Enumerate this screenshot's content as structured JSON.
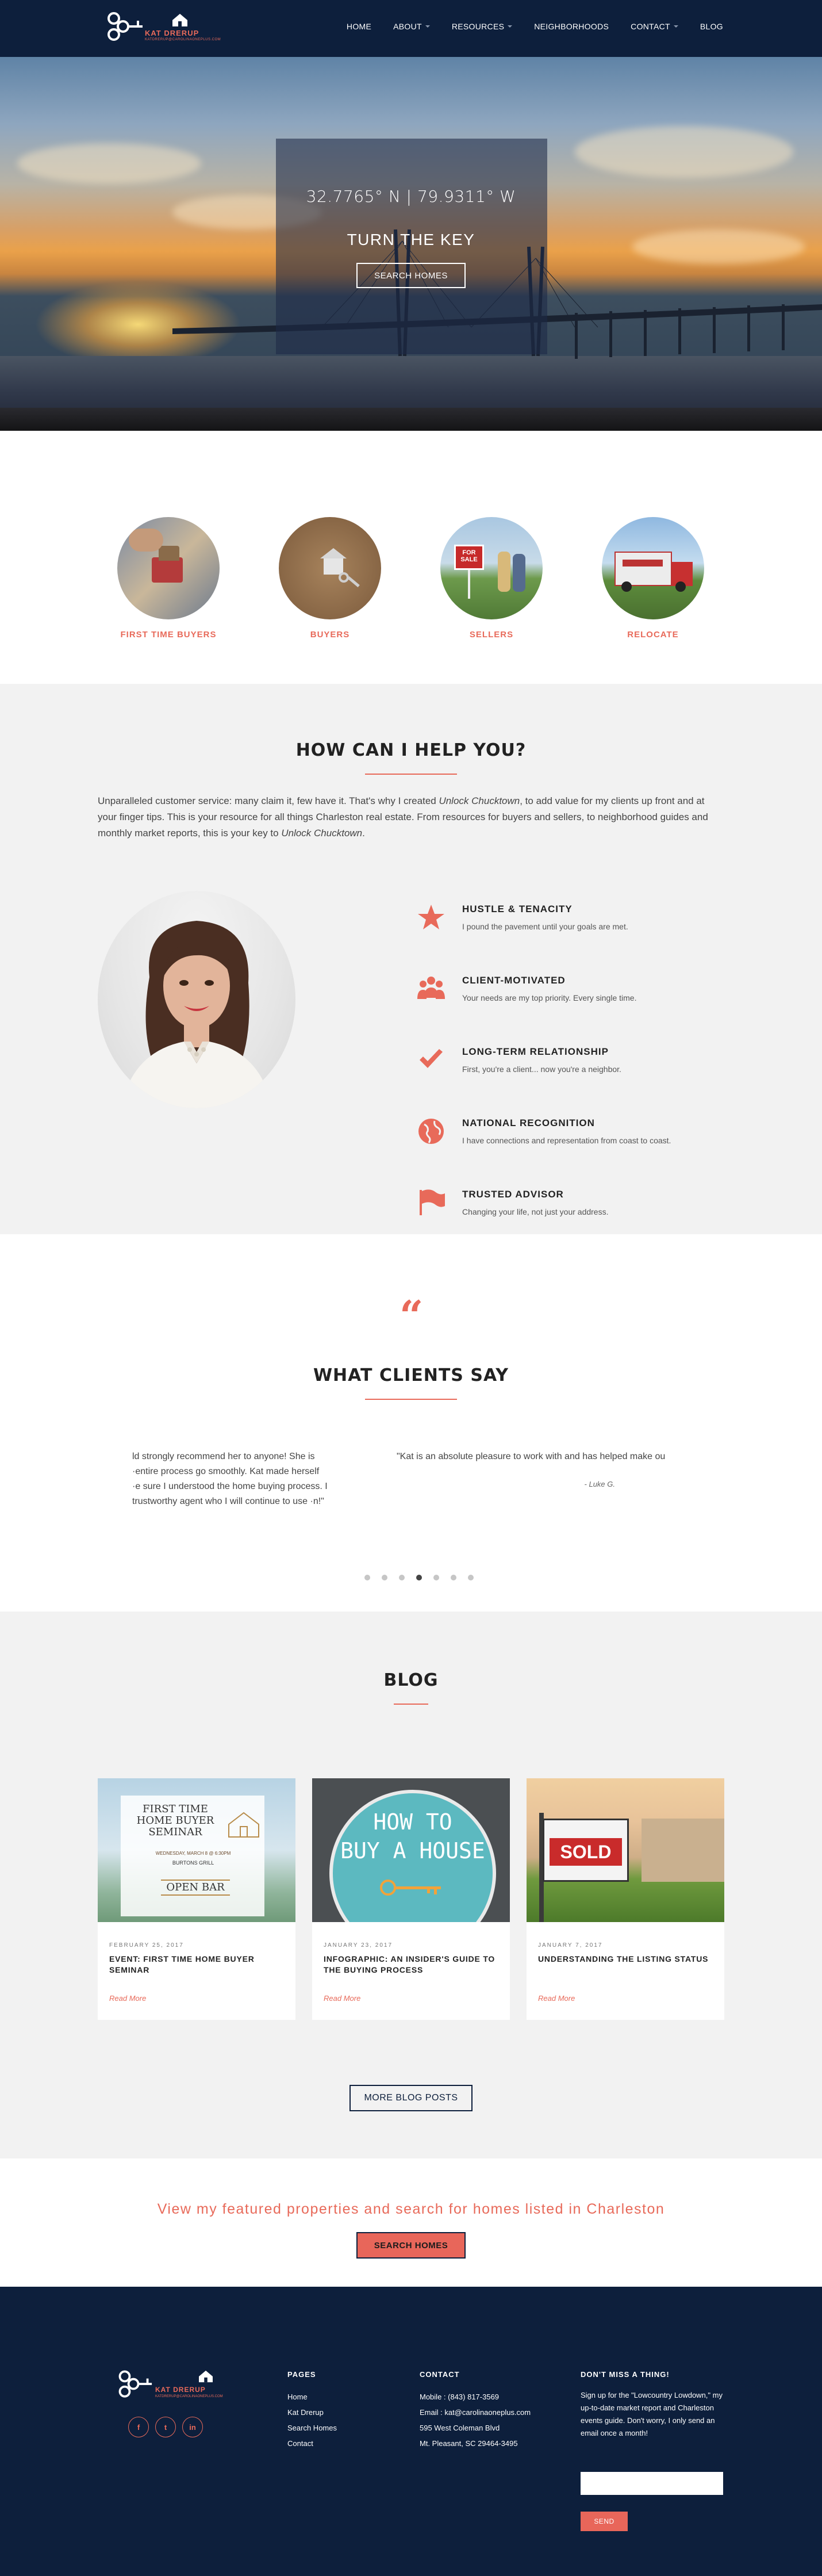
{
  "header": {
    "logo_brand": "KAT DRERUP",
    "logo_sub": "KATDRERUP@CAROLINAONEPLUS.COM",
    "nav": [
      {
        "label": "HOME",
        "has_dropdown": false
      },
      {
        "label": "ABOUT",
        "has_dropdown": true
      },
      {
        "label": "RESOURCES",
        "has_dropdown": true
      },
      {
        "label": "NEIGHBORHOODS",
        "has_dropdown": false
      },
      {
        "label": "CONTACT",
        "has_dropdown": true
      },
      {
        "label": "BLOG",
        "has_dropdown": false
      }
    ]
  },
  "hero": {
    "coords": "32.7765° N | 79.9311° W",
    "tagline": "TURN THE KEY",
    "button": "SEARCH HOMES"
  },
  "categories": [
    {
      "label": "FIRST TIME BUYERS",
      "icon": "keys-handoff-image"
    },
    {
      "label": "BUYERS",
      "icon": "house-keys-image"
    },
    {
      "label": "SELLERS",
      "icon": "for-sale-sign-image"
    },
    {
      "label": "RELOCATE",
      "icon": "moving-truck-image"
    }
  ],
  "help": {
    "title": "HOW CAN I HELP YOU?",
    "intro_1": "Unparalleled customer service: many claim it, few have it. That's why I created ",
    "intro_em_1": "Unlock Chucktown",
    "intro_2": ", to add value for my clients up front and at your finger tips. This is your resource for all things Charleston real estate. From resources for buyers and sellers, to neighborhood guides and monthly market reports, this is your key to ",
    "intro_em_2": "Unlock Chucktown",
    "intro_3": ".",
    "features": [
      {
        "heading": "HUSTLE & TENACITY",
        "text": "I pound the pavement until your goals are met.",
        "icon": "star-icon"
      },
      {
        "heading": "CLIENT-MOTIVATED",
        "text": "Your needs are my top priority. Every single time.",
        "icon": "users-icon"
      },
      {
        "heading": "LONG-TERM RELATIONSHIP",
        "text": "First, you're a client... now you're a neighbor.",
        "icon": "check-icon"
      },
      {
        "heading": "NATIONAL RECOGNITION",
        "text": "I have connections and representation from coast to coast.",
        "icon": "globe-icon"
      },
      {
        "heading": "TRUSTED ADVISOR",
        "text": "Changing your life, not just your address.",
        "icon": "flag-icon"
      }
    ]
  },
  "testimonials": {
    "title": "WHAT CLIENTS SAY",
    "cards": [
      {
        "text": "ld strongly recommend her to anyone! She is ·entire process go smoothly. Kat made herself ·e sure I understood the home buying process. I trustworthy agent who I will continue to use ·n!\"",
        "author": ""
      },
      {
        "text": "\"Kat is an absolute pleasure to work with and has helped make ou",
        "author": "- Luke G."
      }
    ],
    "dot_count": 7,
    "active_dot": 3
  },
  "blog": {
    "title": "BLOG",
    "posts": [
      {
        "date": "FEBRUARY 25, 2017",
        "title": "EVENT: FIRST TIME HOME BUYER SEMINAR",
        "read_more": "Read More",
        "thumb_title": "FIRST TIME HOME BUYER SEMINAR",
        "thumb_date": "WEDNESDAY, MARCH 8 @ 6:30PM",
        "thumb_venue": "BURTONS GRILL",
        "thumb_cta": "OPEN BAR"
      },
      {
        "date": "JANUARY 23, 2017",
        "title": "INFOGRAPHIC: AN INSIDER'S GUIDE TO THE BUYING PROCESS",
        "read_more": "Read More",
        "thumb_title_1": "HOW TO",
        "thumb_title_2": "BUY A HOUSE"
      },
      {
        "date": "JANUARY 7, 2017",
        "title": "UNDERSTANDING THE LISTING STATUS",
        "read_more": "Read More",
        "thumb_sign": "SOLD"
      }
    ],
    "more_button": "MORE BLOG POSTS"
  },
  "featured": {
    "text": "View my featured properties and search for homes listed in Charleston",
    "button": "SEARCH HOMES"
  },
  "footer": {
    "logo_brand": "KAT DRERUP",
    "logo_sub": "KATDRERUP@CAROLINAONEPLUS.COM",
    "socials": [
      {
        "label": "f",
        "icon": "facebook-icon"
      },
      {
        "label": "t",
        "icon": "twitter-icon"
      },
      {
        "label": "in",
        "icon": "linkedin-icon"
      }
    ],
    "pages_heading": "PAGES",
    "pages": [
      "Home",
      "Kat Drerup",
      "Search Homes",
      "Contact"
    ],
    "contact_heading": "CONTACT",
    "contact": [
      "Mobile : (843) 817-3569",
      "Email : kat@carolinaoneplus.com",
      "595 West Coleman Blvd",
      "Mt. Pleasant, SC 29464-3495"
    ],
    "newsletter_heading": "DON'T MISS A THING!",
    "newsletter_text": "Sign up for the \"Lowcountry Lowdown,\" my up-to-date market report and Charleston events guide. Don't worry, I only send an email once a month!",
    "email_placeholder": "",
    "send_button": "SEND"
  },
  "colors": {
    "navy": "#0d1f3c",
    "coral": "#e86a5a",
    "light_gray": "#f2f2f2"
  }
}
